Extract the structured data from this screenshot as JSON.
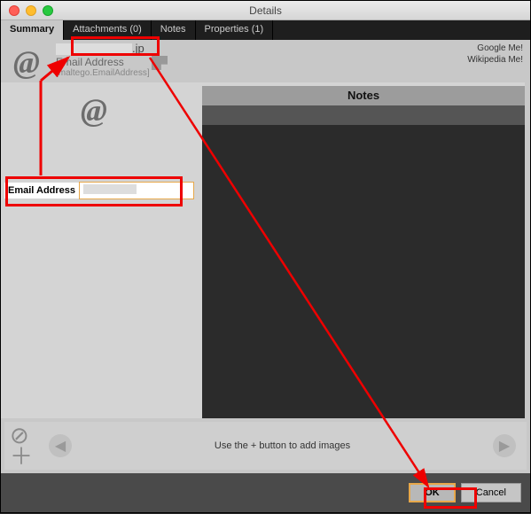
{
  "window": {
    "title": "Details"
  },
  "tabs": {
    "summary": "Summary",
    "attachments": "Attachments (0)",
    "notes": "Notes",
    "properties": "Properties (1)"
  },
  "header": {
    "title_suffix": ".jp",
    "subtitle": "Email Address",
    "entity_type": "[maltego.EmailAddress]"
  },
  "links": {
    "google": "Google Me!",
    "wikipedia": "Wikipedia Me!"
  },
  "field": {
    "label": "Email Address",
    "value": ""
  },
  "notes_panel": {
    "title": "Notes"
  },
  "image_strip": {
    "hint": "Use the + button to add images"
  },
  "buttons": {
    "ok": "OK",
    "cancel": "Cancel"
  },
  "icons": {
    "at": "@",
    "prev": "◀",
    "next": "▶",
    "cancel_circle": "⊘",
    "plus": "＋"
  }
}
